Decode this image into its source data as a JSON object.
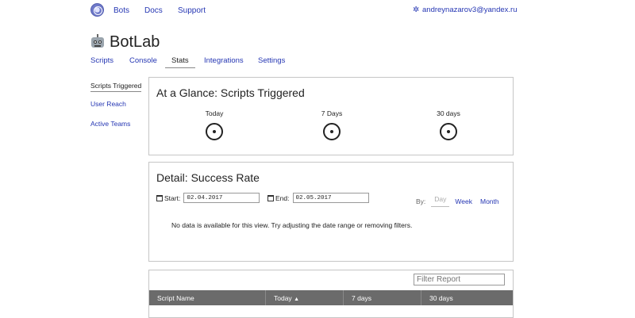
{
  "topnav": {
    "links": [
      "Bots",
      "Docs",
      "Support"
    ],
    "user_email": "andreynazarov3@yandex.ru"
  },
  "app": {
    "title": "BotLab"
  },
  "tabs": [
    "Scripts",
    "Console",
    "Stats",
    "Integrations",
    "Settings"
  ],
  "active_tab": "Stats",
  "sidebar": {
    "items": [
      "Scripts Triggered",
      "User Reach",
      "Active Teams"
    ],
    "active": "Scripts Triggered"
  },
  "glance": {
    "title": "At a Glance: Scripts Triggered",
    "stats": [
      "Today",
      "7 Days",
      "30 days"
    ]
  },
  "detail": {
    "title": "Detail: Success Rate",
    "start_label": "Start:",
    "start_value": "02.04.2017",
    "end_label": "End:",
    "end_value": "02.05.2017",
    "by_label": "By:",
    "by_options": [
      "Day",
      "Week",
      "Month"
    ],
    "by_selected": "Day",
    "no_data": "No data is available for this view. Try adjusting the date range or removing filters."
  },
  "report": {
    "filter_placeholder": "Filter Report",
    "columns": [
      "Script Name",
      "Today",
      "7 days",
      "30 days"
    ],
    "sort_arrow": "▲"
  },
  "colors": {
    "link": "#2536b3",
    "table_header": "#6b6b6b"
  },
  "icons": [
    "logo-icon",
    "gear-icon",
    "robot-icon",
    "calendar-icon",
    "spinner-icon"
  ]
}
